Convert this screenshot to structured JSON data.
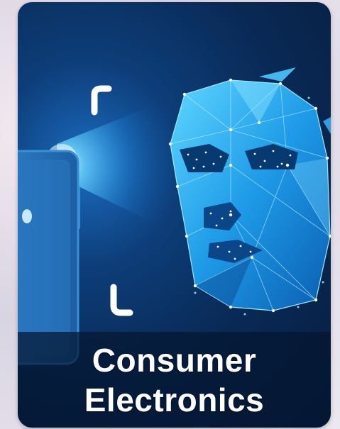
{
  "card": {
    "title_line1": "Consumer",
    "title_line2": "Electronics"
  },
  "icons": {
    "face": "face-scan-icon",
    "phone": "smartphone-icon",
    "brackets": "scan-frame-icon"
  },
  "colors": {
    "card_background": "#092955",
    "accent": "#3ec8ff",
    "text": "#ffffff"
  }
}
